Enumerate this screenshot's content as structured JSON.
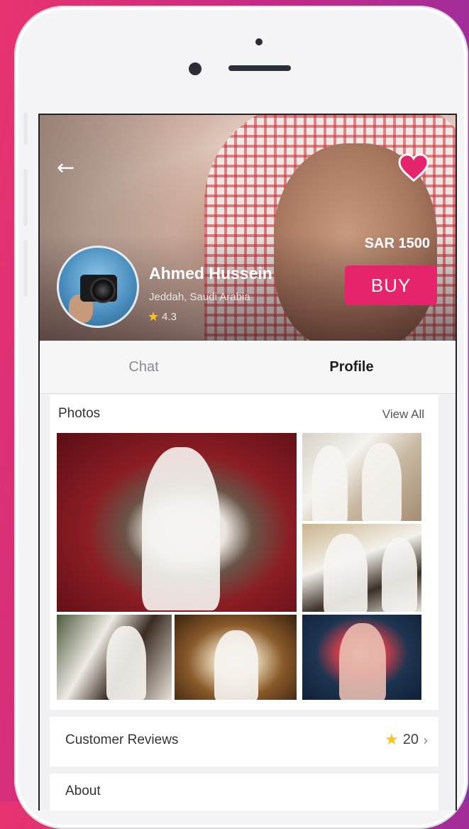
{
  "header": {
    "back_icon": "arrow-left-icon",
    "favorite_icon": "heart-icon",
    "price": "SAR 1500",
    "buy_label": "BUY"
  },
  "profile": {
    "name": "Ahmed Hussein",
    "location": "Jeddah, Saudi Arabia",
    "rating": "4.3"
  },
  "tabs": [
    {
      "label": "Chat",
      "active": false
    },
    {
      "label": "Profile",
      "active": true
    }
  ],
  "photos": {
    "title": "Photos",
    "view_all": "View All"
  },
  "reviews": {
    "label": "Customer Reviews",
    "count": "20"
  },
  "about": {
    "label": "About"
  },
  "colors": {
    "accent": "#e5246b",
    "star": "#f7c325"
  }
}
